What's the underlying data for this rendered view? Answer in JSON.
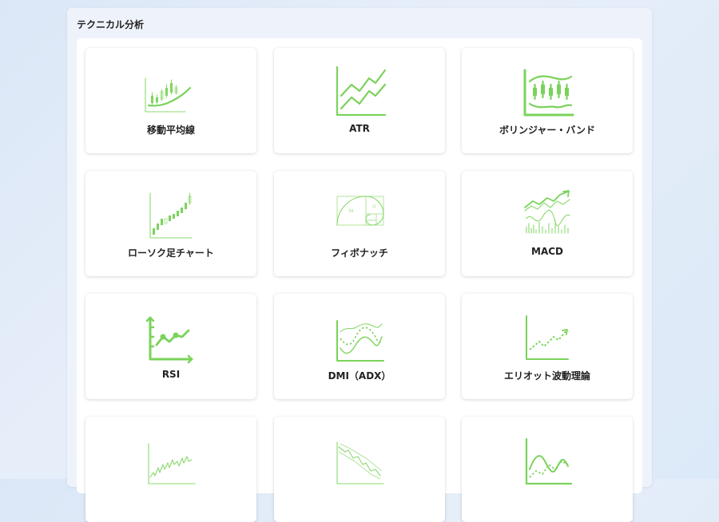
{
  "panel": {
    "title": "テクニカル分析"
  },
  "cards": [
    {
      "label": "移動平均線",
      "icon": "moving-average-chart-icon"
    },
    {
      "label": "ATR",
      "icon": "atr-chart-icon"
    },
    {
      "label": "ボリンジャー・バンド",
      "icon": "bollinger-band-chart-icon"
    },
    {
      "label": "ローソク足チャート",
      "icon": "candlestick-chart-icon"
    },
    {
      "label": "フィボナッチ",
      "icon": "fibonacci-spiral-icon"
    },
    {
      "label": "MACD",
      "icon": "macd-chart-icon"
    },
    {
      "label": "RSI",
      "icon": "rsi-chart-icon"
    },
    {
      "label": "DMI（ADX）",
      "icon": "dmi-chart-icon"
    },
    {
      "label": "エリオット波動理論",
      "icon": "elliott-wave-chart-icon"
    },
    {
      "label": "",
      "icon": "volatility-chart-icon"
    },
    {
      "label": "",
      "icon": "downtrend-chart-icon"
    },
    {
      "label": "",
      "icon": "oscillator-chart-icon"
    }
  ],
  "colors": {
    "accent": "#7ad35a",
    "panel": "#eef3fb",
    "card": "#ffffff"
  }
}
